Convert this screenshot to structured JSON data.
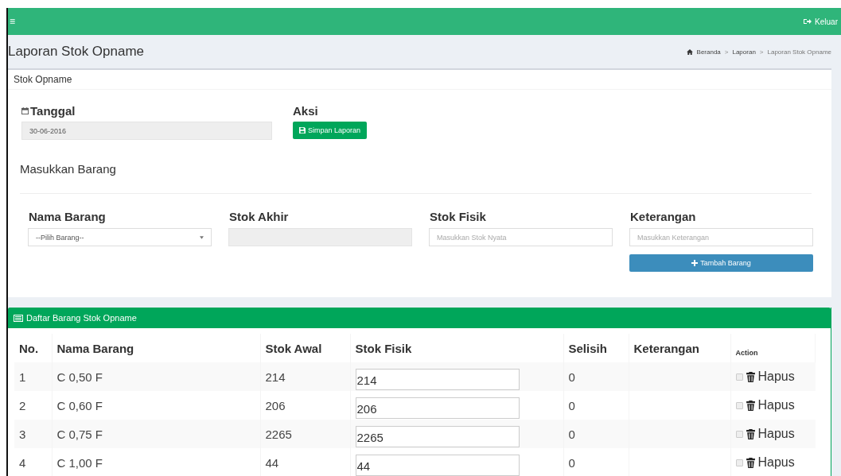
{
  "topbar": {
    "menu_icon": "≡",
    "logout": "Keluar"
  },
  "page": {
    "title": "Laporan Stok Opname",
    "breadcrumb_separator": ">",
    "breadcrumb": [
      {
        "label": "Beranda",
        "kind": "home"
      },
      {
        "label": "Laporan",
        "kind": "link"
      },
      {
        "label": "Laporan Stok Opname",
        "kind": "current"
      }
    ]
  },
  "form_card": {
    "title": "Stok Opname",
    "date_label": "Tanggal",
    "date_value": "30-06-2016",
    "action_label": "Aksi",
    "save_button": "Simpan Laporan",
    "section_title": "Masukkan Barang",
    "fields": [
      {
        "label": "Nama Barang",
        "kind": "select",
        "placeholder": "--Pilih Barang--"
      },
      {
        "label": "Stok Akhir",
        "kind": "readonly"
      },
      {
        "label": "Stok Fisik",
        "kind": "text",
        "placeholder": "Masukkan Stok Nyata"
      },
      {
        "label": "Keterangan",
        "kind": "text",
        "placeholder": "Masukkan Keterangan"
      }
    ],
    "add_button": "Tambah Barang"
  },
  "table_card": {
    "title": "Daftar Barang Stok Opname",
    "columns": [
      "No.",
      "Nama Barang",
      "Stok Awal",
      "Stok Fisik",
      "Selisih",
      "Keterangan",
      "Action"
    ],
    "rows": [
      {
        "no": "1",
        "name": "C 0,50 F",
        "stok_awal": "214",
        "stok_fisik": "214",
        "selisih": "0",
        "checked": false,
        "action": "Hapus"
      },
      {
        "no": "2",
        "name": "C 0,60 F",
        "stok_awal": "206",
        "stok_fisik": "206",
        "selisih": "0",
        "checked": false,
        "action": "Hapus"
      },
      {
        "no": "3",
        "name": "C 0,75 F",
        "stok_awal": "2265",
        "stok_fisik": "2265",
        "selisih": "0",
        "checked": false,
        "action": "Hapus"
      },
      {
        "no": "4",
        "name": "C 1,00 F",
        "stok_awal": "44",
        "stok_fisik": "44",
        "selisih": "0",
        "checked": false,
        "action": "Hapus"
      }
    ]
  }
}
